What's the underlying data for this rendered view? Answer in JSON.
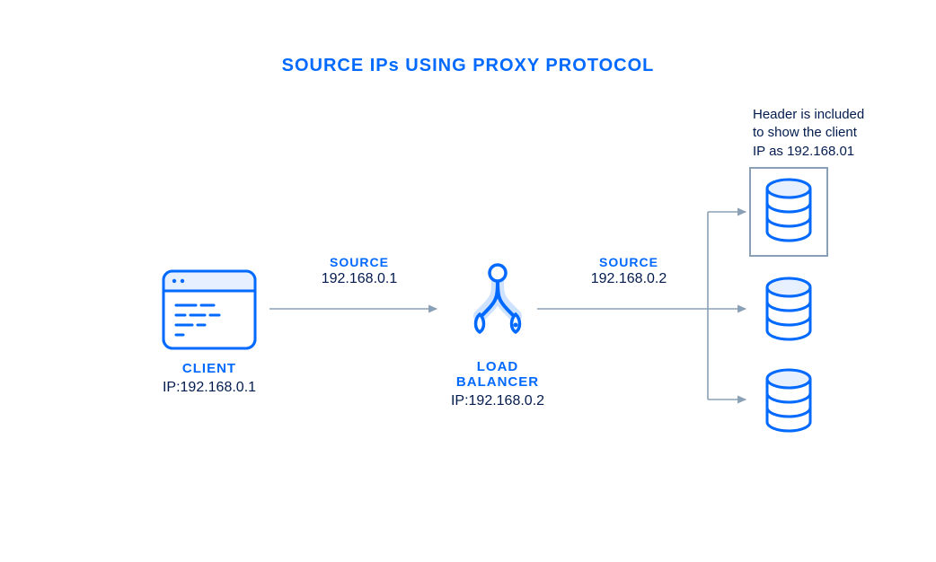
{
  "title": "SOURCE  IPs USING PROXY PROTOCOL",
  "client": {
    "label": "CLIENT",
    "ip": "IP:192.168.0.1"
  },
  "loadBalancer": {
    "label": "LOAD BALANCER",
    "ip": "IP:192.168.0.2"
  },
  "edge1": {
    "label": "SOURCE",
    "value": "192.168.0.1"
  },
  "edge2": {
    "label": "SOURCE",
    "value": "192.168.0.2"
  },
  "annotation": {
    "line1": "Header is included",
    "line2": "to show the client",
    "line3": "IP as 192.168.01"
  },
  "colors": {
    "brand": "#0069ff",
    "text": "#031b4e",
    "line": "#8aa0b5",
    "lineLight": "#a7b6c6"
  }
}
